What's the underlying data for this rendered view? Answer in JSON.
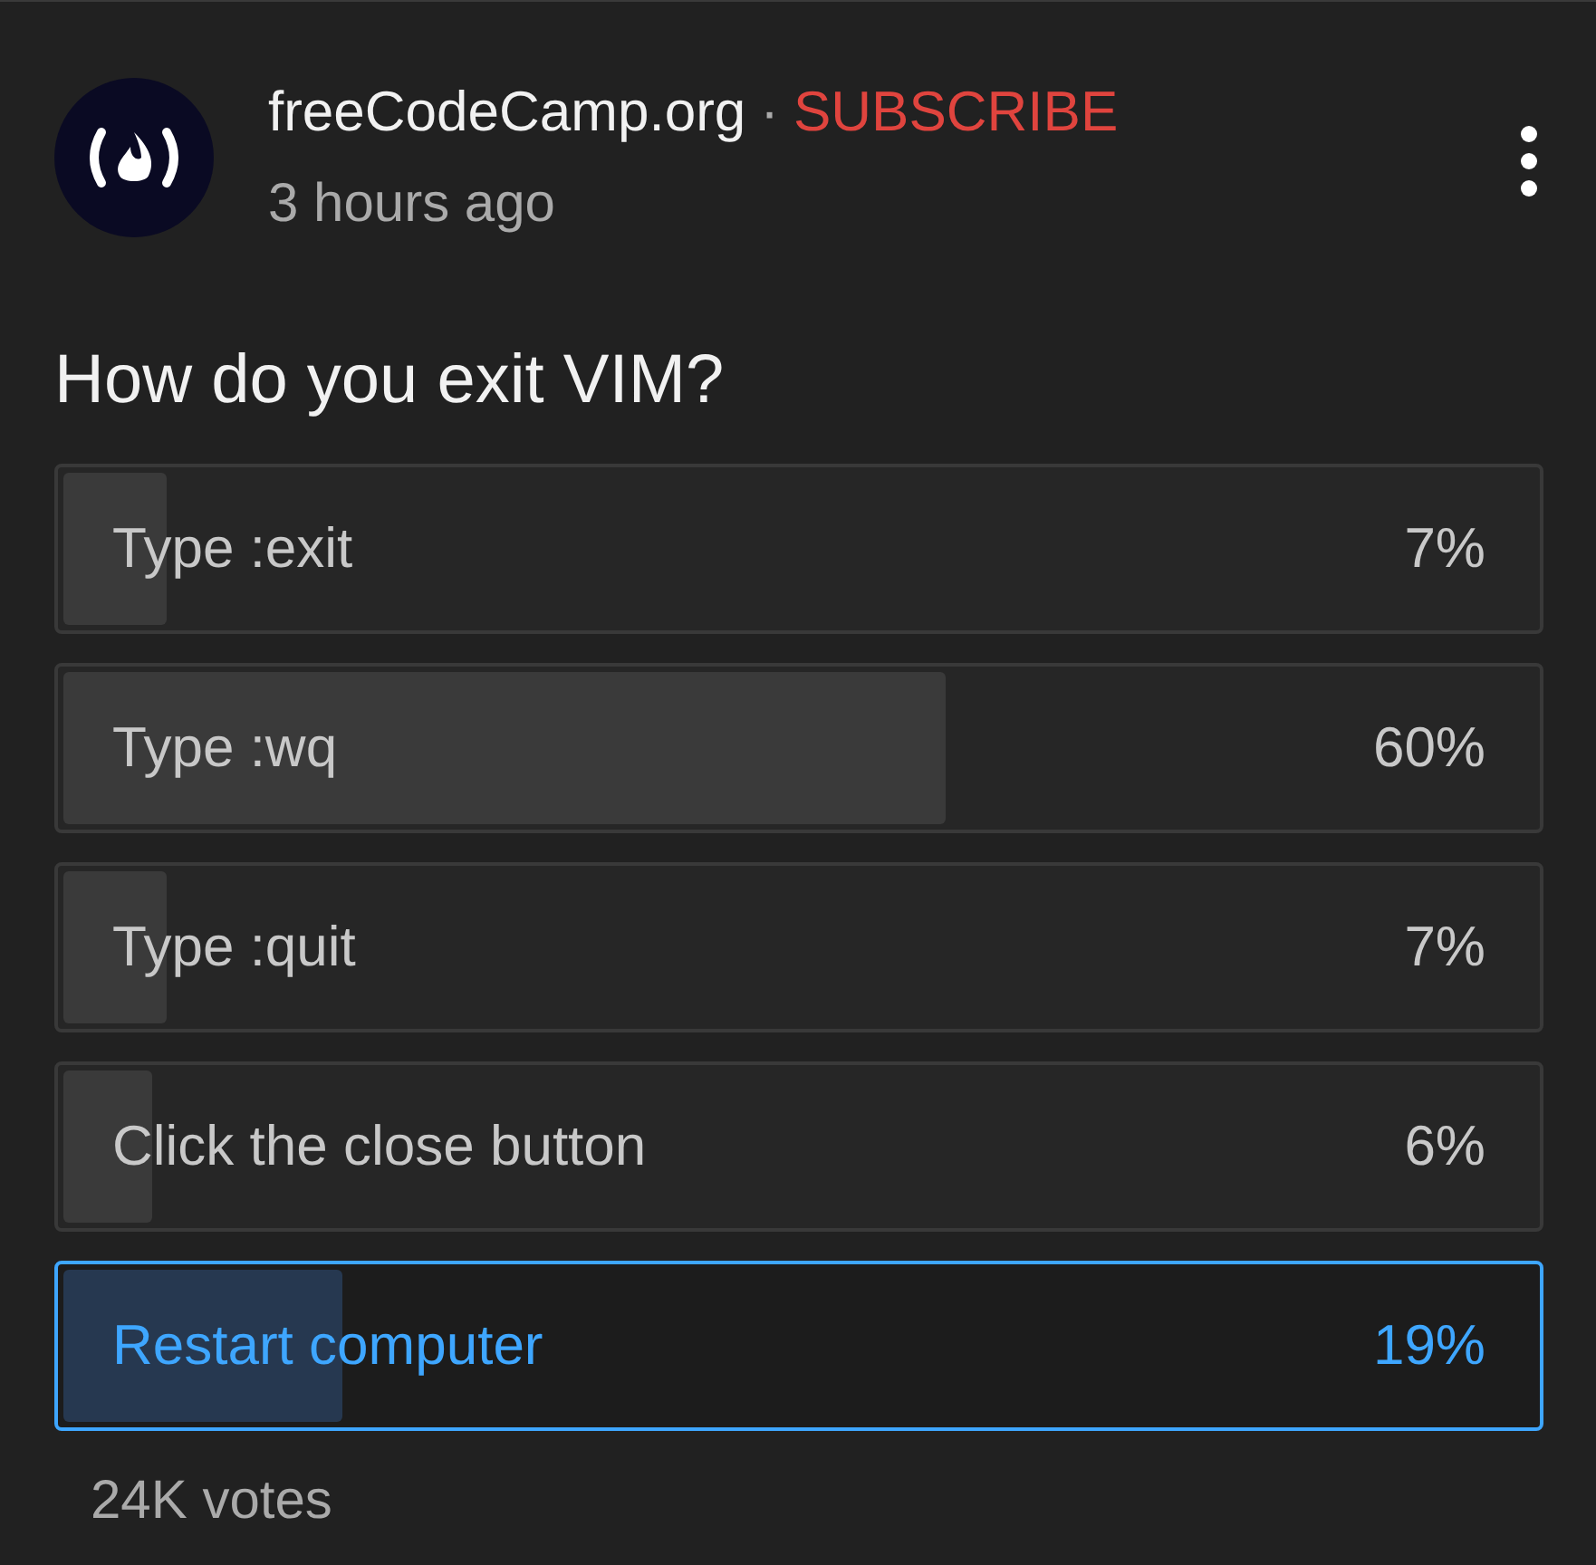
{
  "post": {
    "channel": "freeCodeCamp.org",
    "separator": "·",
    "subscribe": "SUBSCRIBE",
    "time": "3 hours ago"
  },
  "poll": {
    "question": "How do you exit VIM?",
    "options": [
      {
        "label": "Type :exit",
        "percent": "7%",
        "level": 0.07,
        "selected": false
      },
      {
        "label": "Type :wq",
        "percent": "60%",
        "level": 0.6,
        "selected": false
      },
      {
        "label": "Type :quit",
        "percent": "7%",
        "level": 0.07,
        "selected": false
      },
      {
        "label": "Click the close button",
        "percent": "6%",
        "level": 0.06,
        "selected": false
      },
      {
        "label": "Restart computer",
        "percent": "19%",
        "level": 0.19,
        "selected": true
      }
    ],
    "votes": "24K votes"
  }
}
